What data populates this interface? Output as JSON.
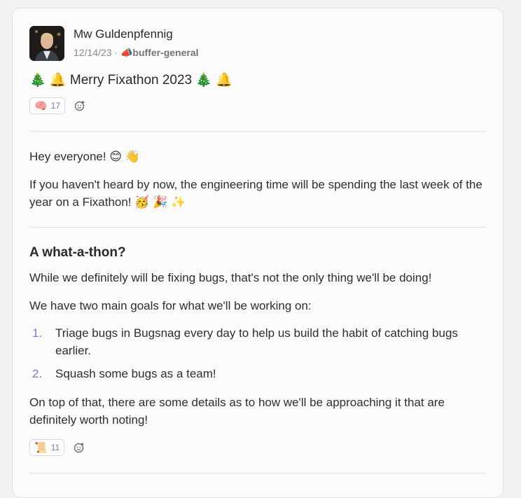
{
  "post": {
    "author": "Mw Guldenpfennig",
    "date": "12/14/23",
    "meta_sep": "·",
    "channel_icon": "📣",
    "channel": "buffer-general",
    "title": "🎄 🔔 Merry Fixathon 2023 🎄 🔔",
    "reaction_top": {
      "emoji": "🧠",
      "count": "17"
    },
    "intro_1": "Hey everyone! 😊 👋",
    "intro_2": "If you haven't heard by now, the engineering time will be spending the last week of the year on a Fixathon! 🥳 🎉 ✨",
    "section_heading": "A what-a-thon?",
    "section_p1": "While we definitely will be fixing bugs, that's not the only thing we'll be doing!",
    "section_p2": "We have two main goals for what we'll be working on:",
    "goals": [
      {
        "num": "1.",
        "text": "Triage bugs in Bugsnag every day to help us build the habit of catching bugs earlier."
      },
      {
        "num": "2.",
        "text": "Squash some bugs as a team!"
      }
    ],
    "section_p3": "On top of that, there are some details as to how we'll be approaching it that are definitely worth noting!",
    "reaction_bottom": {
      "emoji": "📜",
      "count": "11"
    }
  }
}
